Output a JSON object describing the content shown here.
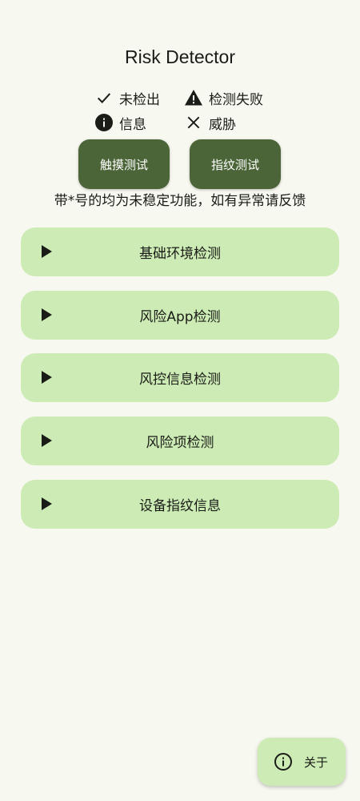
{
  "app": {
    "title": "Risk Detector"
  },
  "legend": {
    "items": [
      {
        "icon": "check-icon",
        "label": "未检出"
      },
      {
        "icon": "warning-icon",
        "label": "检测失败"
      },
      {
        "icon": "info-icon",
        "label": "信息"
      },
      {
        "icon": "close-icon",
        "label": "威胁"
      }
    ]
  },
  "actions": {
    "touch_test": "触摸测试",
    "fingerprint_test": "指纹测试"
  },
  "notice": "带*号的均为未稳定功能，如有异常请反馈",
  "sections": [
    {
      "label": "基础环境检测",
      "icon": "expand-arrow-icon"
    },
    {
      "label": "风险App检测",
      "icon": "expand-arrow-icon"
    },
    {
      "label": "风控信息检测",
      "icon": "expand-arrow-icon"
    },
    {
      "label": "风险项检测",
      "icon": "expand-arrow-icon"
    },
    {
      "label": "设备指纹信息",
      "icon": "expand-arrow-icon"
    }
  ],
  "fab": {
    "label": "关于",
    "icon": "info-icon"
  },
  "colors": {
    "background": "#f7f8f0",
    "primary_button": "#4b6538",
    "section_container": "#cdebb4",
    "text": "#1a1c18"
  }
}
